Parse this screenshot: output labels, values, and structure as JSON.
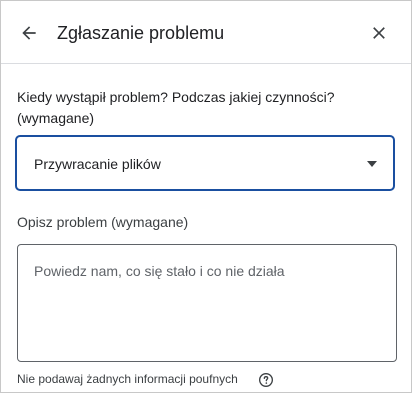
{
  "header": {
    "title": "Zgłaszanie problemu",
    "back_icon": "arrow-left-icon",
    "close_icon": "close-icon"
  },
  "form": {
    "question": "Kiedy wystąpił problem? Podczas jakiej czynności? (wymagane)",
    "selected_option": "Przywracanie plików",
    "description_label": "Opisz problem (wymagane)",
    "description_placeholder": "Powiedz nam, co się stało i co nie działa",
    "description_value": "",
    "hint": "Nie podawaj żadnych informacji poufnych"
  },
  "colors": {
    "accent_border": "#1a4fa0",
    "text": "#202124",
    "icon": "#3c4043"
  }
}
